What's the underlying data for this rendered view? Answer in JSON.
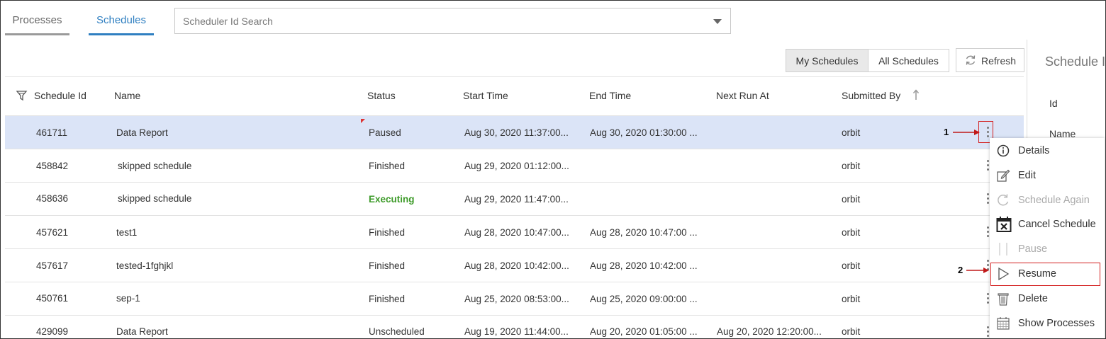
{
  "tabs": {
    "processes": "Processes",
    "schedules": "Schedules"
  },
  "search": {
    "placeholder": "Scheduler Id Search"
  },
  "toolbar": {
    "my_schedules": "My Schedules",
    "all_schedules": "All Schedules",
    "refresh": "Refresh"
  },
  "side_panel": {
    "title": "Schedule I",
    "id_label": "Id",
    "name_label": "Name"
  },
  "table": {
    "headers": {
      "id": "Schedule Id",
      "name": "Name",
      "status": "Status",
      "start": "Start Time",
      "end": "End Time",
      "next": "Next Run At",
      "submitted": "Submitted By"
    },
    "rows": [
      {
        "id": "461711",
        "name": "Data Report",
        "status": "Paused",
        "start": "Aug 30, 2020 11:37:00...",
        "end": "Aug 30, 2020 01:30:00 ...",
        "next": "",
        "submitted": "orbit"
      },
      {
        "id": "458842",
        "name": "skipped schedule",
        "status": "Finished",
        "start": "Aug 29, 2020 01:12:00...",
        "end": "",
        "next": "",
        "submitted": "orbit"
      },
      {
        "id": "458636",
        "name": "skipped schedule",
        "status": "Executing",
        "start": "Aug 29, 2020 11:47:00...",
        "end": "",
        "next": "",
        "submitted": "orbit"
      },
      {
        "id": "457621",
        "name": "test1",
        "status": "Finished",
        "start": "Aug 28, 2020 10:47:00...",
        "end": "Aug 28, 2020 10:47:00 ...",
        "next": "",
        "submitted": "orbit"
      },
      {
        "id": "457617",
        "name": "tested-1fghjkl",
        "status": "Finished",
        "start": "Aug 28, 2020 10:42:00...",
        "end": "Aug 28, 2020 10:42:00 ...",
        "next": "",
        "submitted": "orbit"
      },
      {
        "id": "450761",
        "name": "sep-1",
        "status": "Finished",
        "start": "Aug 25, 2020 08:53:00...",
        "end": "Aug 25, 2020 09:00:00 ...",
        "next": "",
        "submitted": "orbit"
      },
      {
        "id": "429099",
        "name": "Data Report",
        "status": "Unscheduled",
        "start": "Aug 19, 2020 11:44:00...",
        "end": "Aug 20, 2020 01:05:00 ...",
        "next": "Aug 20, 2020 12:20:00...",
        "submitted": "orbit"
      }
    ]
  },
  "menu": {
    "details": "Details",
    "edit": "Edit",
    "schedule_again": "Schedule Again",
    "cancel_schedule": "Cancel Schedule",
    "pause": "Pause",
    "resume": "Resume",
    "delete": "Delete",
    "show_processes": "Show Processes"
  },
  "annotations": {
    "one": "1",
    "two": "2"
  },
  "colors": {
    "accent": "#2f7fc1",
    "selected_row": "#dbe4f7",
    "executing": "#3e9b2a",
    "annotation_red": "#d42020"
  }
}
